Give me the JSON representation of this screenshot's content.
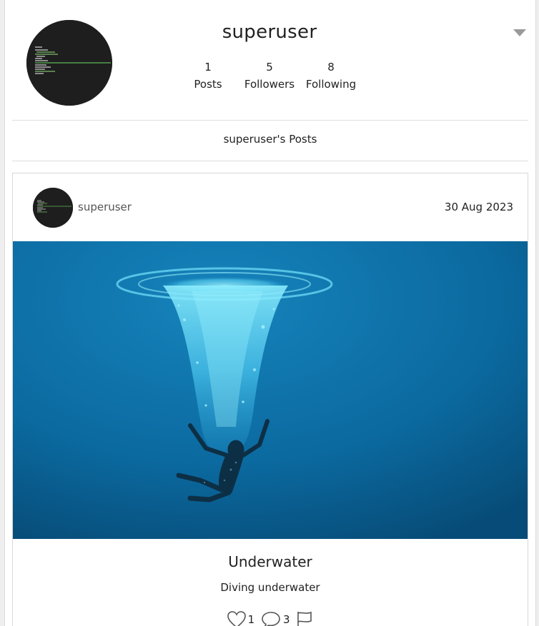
{
  "profile": {
    "username": "superuser",
    "stats": [
      {
        "value": "1",
        "label": "Posts"
      },
      {
        "value": "5",
        "label": "Followers"
      },
      {
        "value": "8",
        "label": "Following"
      }
    ],
    "menu_icon": "caret-down-icon"
  },
  "posts_section": {
    "heading": "superuser's Posts"
  },
  "post": {
    "author": "superuser",
    "date": "30 Aug 2023",
    "title": "Underwater",
    "description": "Diving underwater",
    "likes": "1",
    "comments": "3",
    "icons": {
      "like": "heart-icon",
      "comment": "comment-bubble-icon",
      "report": "flag-icon"
    }
  },
  "colors": {
    "avatar_bg": "#1e1e1e",
    "water_deep": "#0a5a8c",
    "water_light": "#1b7fb6",
    "bubbles": "#5fd4f5"
  }
}
